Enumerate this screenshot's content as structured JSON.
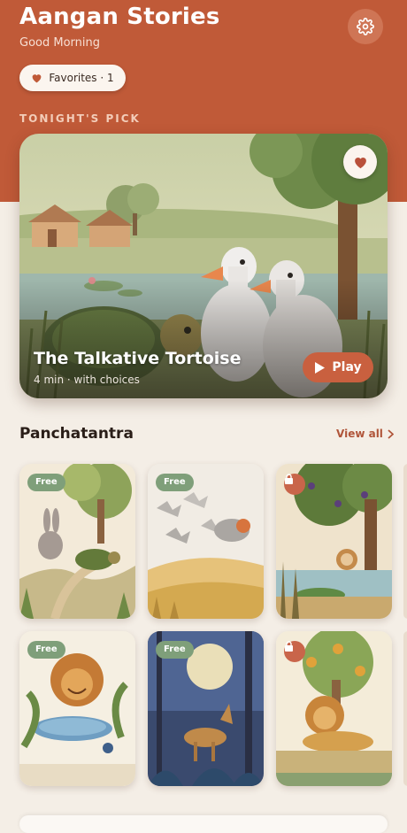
{
  "header": {
    "app_title": "Aangan Stories",
    "greeting": "Good Morning",
    "favorites_chip": "Favorites · 1",
    "settings_icon": "gear-icon"
  },
  "tonights_pick": {
    "section_label": "TONIGHT'S PICK",
    "title": "The Talkative Tortoise",
    "meta": "4 min · with choices",
    "play_label": "Play",
    "favorited": true
  },
  "panchatantra": {
    "title": "Panchatantra",
    "view_all": "View all",
    "tiles": [
      {
        "badge": "Free",
        "locked": false,
        "scene": "rabbit-and-tortoise"
      },
      {
        "badge": "Free",
        "locked": false,
        "scene": "birds-over-fields"
      },
      {
        "badge": "",
        "locked": true,
        "scene": "monkey-and-crocodile"
      },
      {
        "badge": "Free",
        "locked": false,
        "scene": "lion-at-pond"
      },
      {
        "badge": "Free",
        "locked": false,
        "scene": "jackal-in-moonlit-forest"
      },
      {
        "badge": "",
        "locked": true,
        "scene": "lion-under-tree"
      }
    ]
  },
  "colors": {
    "header_bg": "#c05a38",
    "page_bg": "#f4eee6",
    "accent": "#c9603f",
    "free_badge": "#7f9f7a"
  }
}
